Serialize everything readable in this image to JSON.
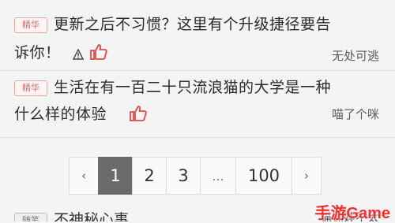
{
  "posts": [
    {
      "badge": "精华",
      "title_line1": "更新之后不习惯？这里有个升级捷径要告",
      "title_line2": "诉你！",
      "author": "无处可逃",
      "icons": [
        "warning-icon",
        "thumbs-up-icon"
      ]
    },
    {
      "badge": "精华",
      "title_line1": "生活在有一百二十只流浪猫的大学是一种",
      "title_line2": "什么样的体验",
      "author": "喵了个咪",
      "icons": [
        "thumbs-up-icon"
      ]
    }
  ],
  "pagination": {
    "prev": "‹",
    "pages": [
      "1",
      "2",
      "3"
    ],
    "ellipsis": "...",
    "last": "100",
    "next": "›",
    "current": "1"
  },
  "partial_post": {
    "badge": "随笔",
    "title": "不神秘心事",
    "author": "猫猫娃不太"
  },
  "watermark": "手游Game",
  "colors": {
    "badge_text": "#d46a6a",
    "like_icon": "#e04848",
    "active_page": "#6b6b6b",
    "watermark": "#ff2b2b"
  }
}
